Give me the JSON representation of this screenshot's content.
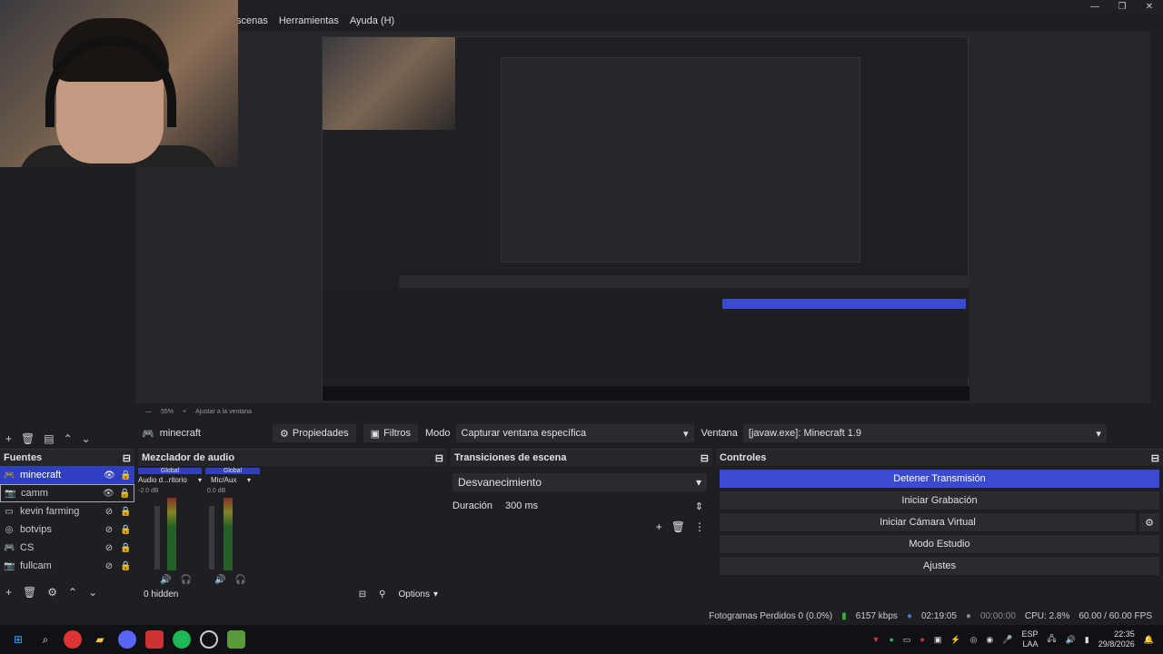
{
  "menu": {
    "items": [
      "scenas",
      "Herramientas",
      "Ayuda (H)"
    ]
  },
  "toolbar": {
    "scene_name": "minecraft",
    "props_label": "Propiedades",
    "filters_label": "Filtros",
    "mode_label": "Modo",
    "mode_value": "Capturar ventana específica",
    "window_label": "Ventana",
    "window_value": "[javaw.exe]: Minecraft 1.9"
  },
  "preview": {
    "zoom": "55%",
    "fit_label": "Ajustar a la ventana"
  },
  "sources": {
    "title": "Fuentes",
    "items": [
      {
        "name": "minecraft"
      },
      {
        "name": "camm"
      },
      {
        "name": "kevin farming"
      },
      {
        "name": "botvips"
      },
      {
        "name": "CS"
      },
      {
        "name": "fullcam"
      }
    ]
  },
  "mixer": {
    "title": "Mezclador de audio",
    "channels": [
      {
        "tag": "Global",
        "name": "Audio d...ritorio",
        "db": "-2.0 dB"
      },
      {
        "tag": "Global",
        "name": "Mic/Aux",
        "db": "0.0 dB"
      }
    ],
    "scale": [
      "0",
      "-6",
      "-12",
      "-18",
      "-24",
      "-30",
      "-36",
      "-42",
      "-48",
      "-54",
      "-60"
    ],
    "hidden": "0 hidden",
    "options": "Options"
  },
  "transitions": {
    "title": "Transiciones de escena",
    "selected": "Desvanecimiento",
    "duration_label": "Duración",
    "duration_value": "300 ms"
  },
  "controls": {
    "title": "Controles",
    "stop_stream": "Detener Transmisión",
    "start_record": "Iniciar Grabación",
    "start_vcam": "Iniciar Cámara Virtual",
    "studio_mode": "Modo Estudio",
    "settings": "Ajustes"
  },
  "status": {
    "dropped": "Fotogramas Perdidos 0 (0.0%)",
    "bitrate": "6157 kbps",
    "stream_time": "02:19:05",
    "record_time": "00:00:00",
    "cpu": "CPU: 2.8%",
    "fps": "60.00 / 60.00 FPS"
  },
  "taskbar": {
    "lang": "ESP",
    "lang2": "LAA",
    "time": "22:35",
    "date": "29/8/2026"
  }
}
